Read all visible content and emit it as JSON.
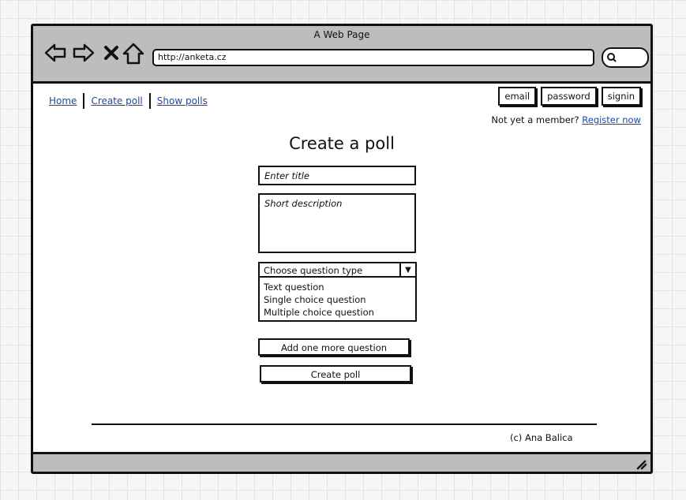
{
  "window": {
    "title": "A Web Page"
  },
  "browser": {
    "url": "http://anketa.cz"
  },
  "nav": {
    "links": [
      "Home",
      "Create poll",
      "Show polls"
    ]
  },
  "auth": {
    "email_label": "email",
    "password_label": "password",
    "signin_label": "signin",
    "member_prompt": "Not yet a member?",
    "register_link": "Register now"
  },
  "form": {
    "heading": "Create a poll",
    "title_placeholder": "Enter title",
    "description_placeholder": "Short description",
    "question_type_label": "Choose question type",
    "question_types": [
      "Text question",
      "Single choice question",
      "Multiple choice question"
    ],
    "add_question_button": "Add one more question",
    "create_button": "Create poll"
  },
  "footer": {
    "copyright": "(c) Ana Balica"
  },
  "icons": {
    "back": "arrow-left-icon",
    "forward": "arrow-right-icon",
    "stop": "close-icon",
    "home": "home-icon",
    "search": "search-icon",
    "resize": "resize-grip-icon"
  }
}
